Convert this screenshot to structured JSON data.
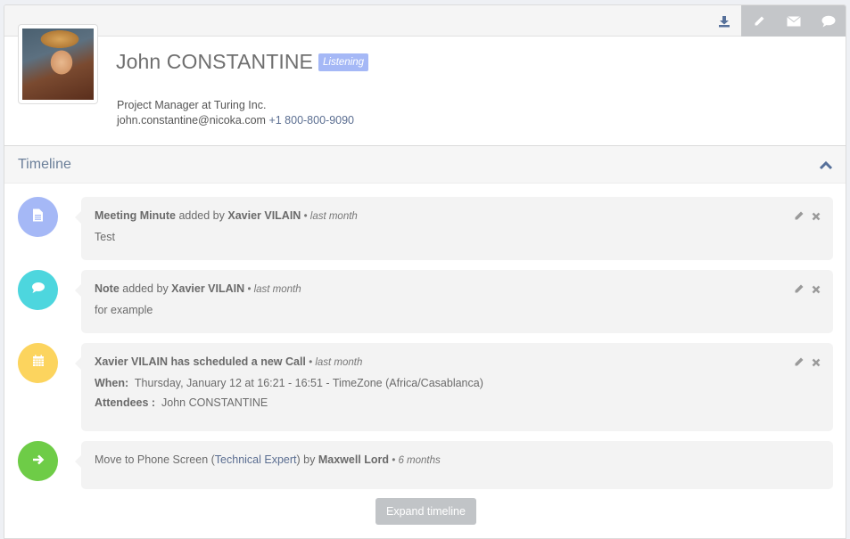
{
  "toolbar": {
    "buttons": [
      {
        "name": "download-icon",
        "style": "plain"
      },
      {
        "name": "pencil-icon",
        "style": "grey"
      },
      {
        "name": "envelope-icon",
        "style": "grey"
      },
      {
        "name": "comment-icon",
        "style": "grey"
      }
    ]
  },
  "profile": {
    "name": "John CONSTANTINE",
    "status_badge": "Listening",
    "job_title": "Project Manager at Turing Inc.",
    "email": "john.constantine@nicoka.com",
    "phone": "+1 800-800-9090",
    "avatar_alt": "John Constantine avatar"
  },
  "timeline": {
    "title": "Timeline",
    "toggle_icon": "chevron-up-icon",
    "items": [
      {
        "type": "meeting-minute",
        "icon": "file-text-icon",
        "color": "#a5b8f6",
        "subject": "Meeting Minute",
        "connector": " added by ",
        "author": "Xavier VILAIN",
        "separator": " • ",
        "time": "last month",
        "body": "Test"
      },
      {
        "type": "note",
        "icon": "comment-icon",
        "color": "#4dd6de",
        "subject": "Note",
        "connector": " added by ",
        "author": "Xavier VILAIN",
        "separator": " • ",
        "time": "last month",
        "body": "for example"
      },
      {
        "type": "call",
        "icon": "calendar-icon",
        "color": "#fcd45e",
        "author": "Xavier VILAIN",
        "action": " has scheduled a new Call",
        "separator": " • ",
        "time": "last month",
        "when_label": "When:",
        "when_value": "Thursday, January 12 at 16:21 - 16:51 - TimeZone (Africa/Casablanca)",
        "attendees_label": "Attendees :",
        "attendees_value": "John CONSTANTINE"
      },
      {
        "type": "stage-move",
        "icon": "arrow-right-icon",
        "color": "#6ecc47",
        "prefix": "Move to Phone Screen (",
        "link": "Technical Expert",
        "suffix": ") by ",
        "author": "Maxwell Lord",
        "separator": " • ",
        "time": "6 months"
      }
    ],
    "expand_label": "Expand timeline"
  }
}
